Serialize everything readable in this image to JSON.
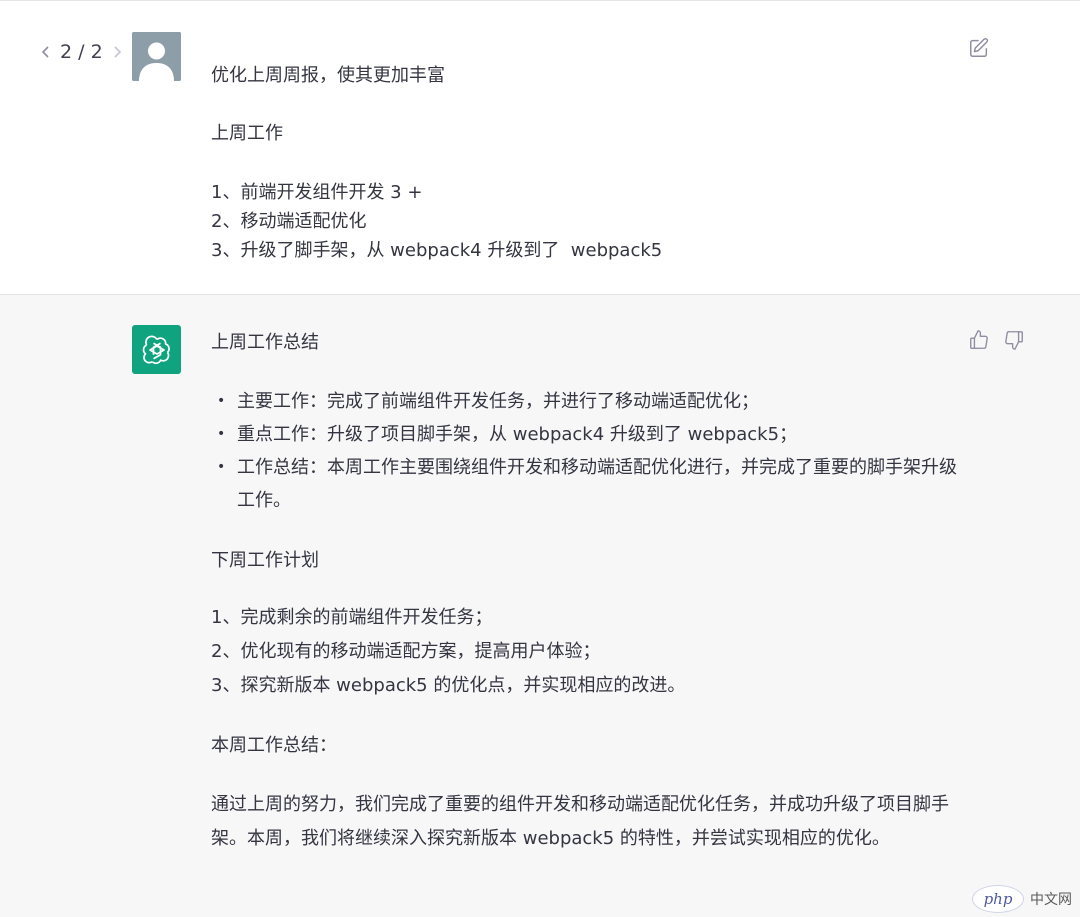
{
  "user": {
    "pager": "2 / 2",
    "paragraphs": [
      "优化上周周报，使其更加丰富",
      "上周工作",
      "1、前端开发组件开发 3 +",
      "2、移动端适配优化",
      "3、升级了脚手架，从 webpack4 升级到了  webpack5"
    ]
  },
  "assistant": {
    "heading_summary": "上周工作总结",
    "bullets": [
      "主要工作：完成了前端组件开发任务，并进行了移动端适配优化；",
      "重点工作：升级了项目脚手架，从 webpack4 升级到了 webpack5；",
      "工作总结：本周工作主要围绕组件开发和移动端适配优化进行，并完成了重要的脚手架升级工作。"
    ],
    "heading_plan": "下周工作计划",
    "plan": [
      "1、完成剩余的前端组件开发任务；",
      "2、优化现有的移动端适配方案，提高用户体验；",
      "3、探究新版本 webpack5 的优化点，并实现相应的改进。"
    ],
    "heading_week": "本周工作总结：",
    "closing": "通过上周的努力，我们完成了重要的组件开发和移动端适配优化任务，并成功升级了项目脚手架。本周，我们将继续深入探究新版本 webpack5 的特性，并尝试实现相应的优化。"
  },
  "watermark": {
    "logo": "php",
    "text": "中文网"
  },
  "colors": {
    "assistant_bg": "#f7f7f8",
    "gpt_green": "#10a37f",
    "text": "#343541"
  },
  "icons": {
    "edit": "edit-icon",
    "thumbs_up": "thumbs-up-icon",
    "thumbs_down": "thumbs-down-icon",
    "prev": "chevron-left-icon",
    "next": "chevron-right-icon"
  }
}
